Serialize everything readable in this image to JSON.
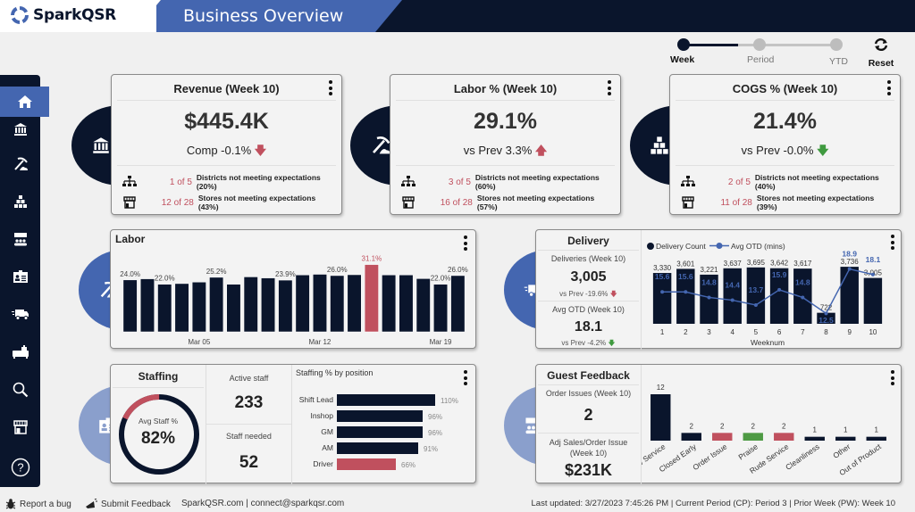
{
  "header": {
    "brand": "SparkQSR",
    "title": "Business Overview"
  },
  "period_selector": {
    "options": [
      "Week",
      "Period",
      "YTD"
    ],
    "selected": "Week",
    "reset_label": "Reset"
  },
  "sidebar": {
    "items": [
      {
        "icon": "home-icon",
        "active": true
      },
      {
        "icon": "bank-icon"
      },
      {
        "icon": "pickaxe-icon"
      },
      {
        "icon": "boxes-icon"
      },
      {
        "icon": "feedback-group-icon"
      },
      {
        "icon": "id-card-icon"
      },
      {
        "icon": "delivery-truck-icon"
      },
      {
        "icon": "catering-icon"
      },
      {
        "icon": "search-icon"
      },
      {
        "icon": "store-icon"
      },
      {
        "icon": "help-icon"
      }
    ]
  },
  "kpis": [
    {
      "title": "Revenue (Week 10)",
      "value": "$445.4K",
      "comparison": "Comp -0.1%",
      "arrow": "down",
      "arrow_color": "#c0505e",
      "districts_count": "1 of 5",
      "districts_text": "Districts not meeting expectations (20%)",
      "stores_count": "12 of 28",
      "stores_text": "Stores not meeting expectations (43%)"
    },
    {
      "title": "Labor % (Week 10)",
      "value": "29.1%",
      "comparison": "vs Prev 3.3%",
      "arrow": "up",
      "arrow_color": "#c0505e",
      "districts_count": "3 of 5",
      "districts_text": "Districts not meeting expectations (60%)",
      "stores_count": "16 of 28",
      "stores_text": "Stores not meeting expectations (57%)"
    },
    {
      "title": "COGS % (Week 10)",
      "value": "21.4%",
      "comparison": "vs Prev -0.0%",
      "arrow": "down",
      "arrow_color": "#3f9a3f",
      "districts_count": "2 of 5",
      "districts_text": "Districts not meeting expectations (40%)",
      "stores_count": "11 of 28",
      "stores_text": "Stores not meeting expectations (39%)"
    }
  ],
  "labor": {
    "title": "Labor"
  },
  "delivery": {
    "title": "Delivery",
    "deliveries_label": "Deliveries (Week 10)",
    "deliveries_value": "3,005",
    "deliveries_comp": "vs Prev -19.6%",
    "otd_label": "Avg OTD (Week 10)",
    "otd_value": "18.1",
    "otd_comp": "vs Prev -4.2%"
  },
  "staffing": {
    "title": "Staffing",
    "gauge_label": "Avg Staff %",
    "gauge_value": "82%",
    "gauge_fraction": 0.82,
    "active_label": "Active staff",
    "active_value": "233",
    "needed_label": "Staff needed",
    "needed_value": "52"
  },
  "guest_feedback": {
    "title": "Guest Feedback",
    "order_issues_label": "Order Issues (Week 10)",
    "order_issues_value": "2",
    "adj_sales_label": "Adj Sales/Order Issue (Week 10)",
    "adj_sales_value": "$231K"
  },
  "colors": {
    "navy": "#0a152c",
    "accent_blue": "#4466b0",
    "light_blue": "#8a9fcc",
    "red": "#c0505e",
    "green": "#4e9a44"
  },
  "chart_data": [
    {
      "id": "labor",
      "type": "bar",
      "title": "Labor",
      "x_tick_labels": [
        "Mar 05",
        "Mar 12",
        "Mar 19"
      ],
      "x_tick_indices": [
        5,
        12,
        19
      ],
      "values": [
        24.0,
        24.5,
        22.0,
        22.3,
        23.0,
        25.2,
        22.0,
        25.4,
        24.9,
        23.9,
        26.3,
        26.6,
        26.0,
        26.4,
        31.1,
        26.3,
        26.3,
        24.6,
        22.0,
        26.0
      ],
      "labels": [
        "24.0%",
        "",
        "22.0%",
        "",
        "",
        "25.2%",
        "",
        "",
        "",
        "23.9%",
        "",
        "",
        "26.0%",
        "",
        "31.1%",
        "",
        "",
        "",
        "22.0%",
        "26.0%"
      ],
      "highlight_index": 14,
      "ylim": [
        0,
        33
      ]
    },
    {
      "id": "delivery",
      "type": "bar+line",
      "categories": [
        "1",
        "2",
        "3",
        "4",
        "5",
        "6",
        "7",
        "8",
        "9",
        "10"
      ],
      "xlabel": "Weeknum",
      "series": [
        {
          "name": "Delivery Count",
          "type": "bar",
          "values": [
            3330,
            3601,
            3221,
            3637,
            3695,
            3642,
            3617,
            722,
            3736,
            3005
          ]
        },
        {
          "name": "Avg OTD (mins)",
          "type": "line",
          "values": [
            15.6,
            15.6,
            14.8,
            14.4,
            13.7,
            15.9,
            14.8,
            12.5,
            18.9,
            18.1
          ]
        }
      ],
      "bar_labels": [
        "3,330",
        "3,601",
        "3,221",
        "3,637",
        "3,695",
        "3,642",
        "3,617",
        "722",
        "3,736",
        "3,005"
      ],
      "legend": "top-left"
    },
    {
      "id": "staffing_by_position",
      "type": "bar",
      "orientation": "horizontal",
      "title": "Staffing % by position",
      "categories": [
        "Shift Lead",
        "Inshop",
        "GM",
        "AM",
        "Driver"
      ],
      "values": [
        110,
        96,
        96,
        91,
        66
      ],
      "labels": [
        "110%",
        "96%",
        "96%",
        "91%",
        "66%"
      ],
      "highlight_index": 4
    },
    {
      "id": "guest_feedback",
      "type": "bar",
      "categories": [
        "Slow Service",
        "Closed Early",
        "Order Issue",
        "Praise",
        "Rude Service",
        "Cleanliness",
        "Other",
        "Out of Product"
      ],
      "values": [
        12,
        2,
        2,
        2,
        2,
        1,
        1,
        1
      ],
      "bar_colors": [
        "navy",
        "navy",
        "red",
        "green",
        "red",
        "navy",
        "navy",
        "navy"
      ]
    }
  ],
  "footer": {
    "report_bug": "Report a bug",
    "submit_feedback": "Submit Feedback",
    "contact": "SparkQSR.com | connect@sparkqsr.com",
    "status": "Last updated: 3/27/2023 7:45:26 PM | Current Period (CP): Period 3 | Prior Week (PW): Week 10"
  }
}
